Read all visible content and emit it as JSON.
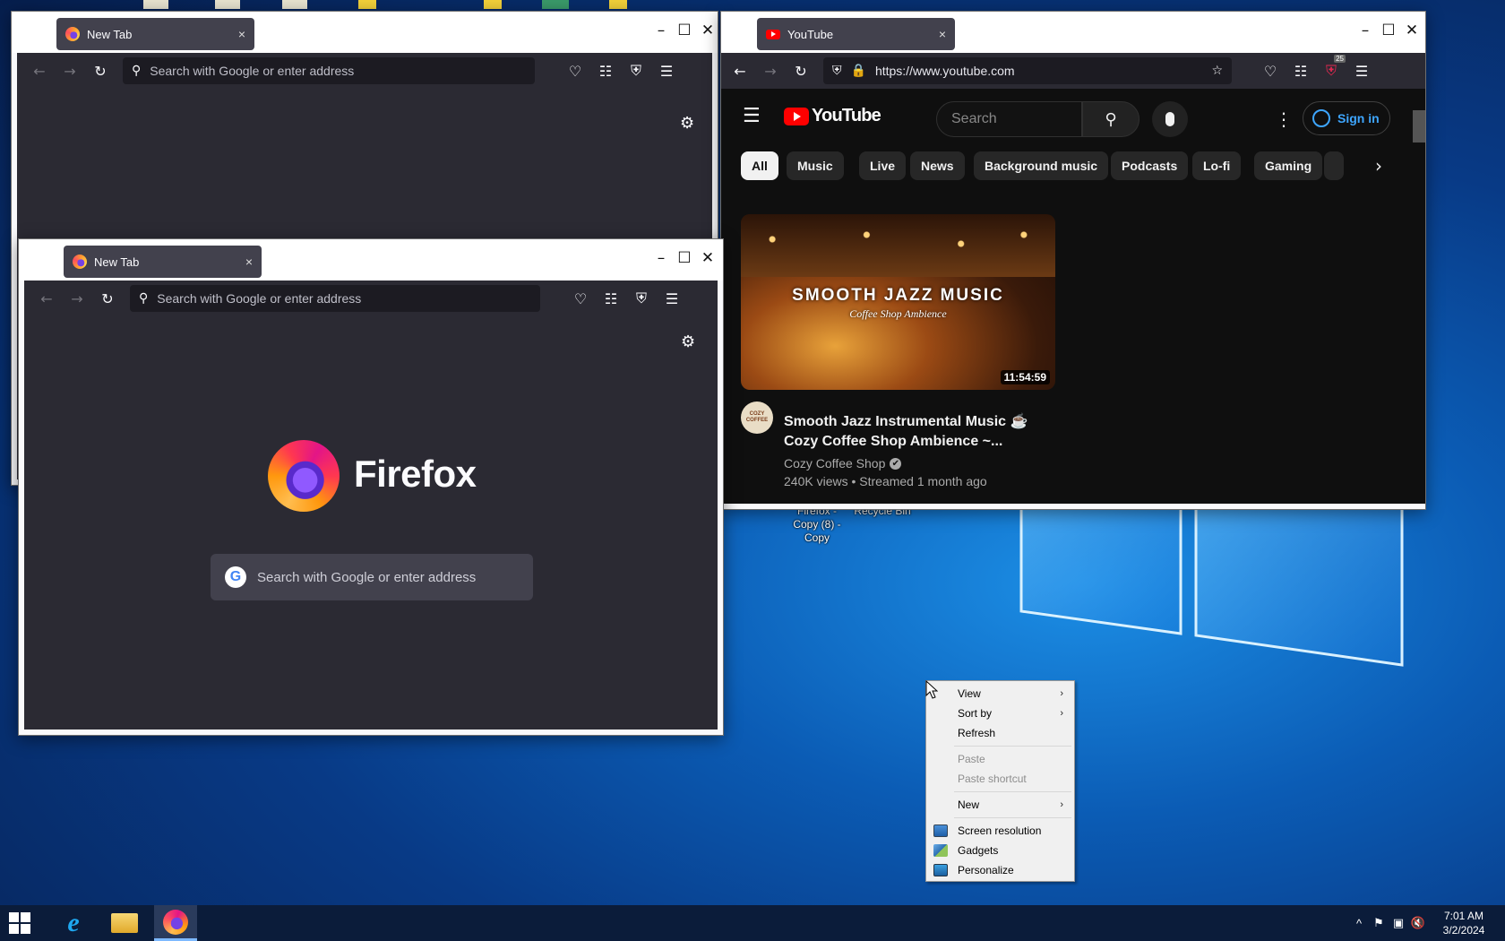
{
  "desktop": {
    "icons": [
      {
        "label": "Firefox - Copy (8) - Copy"
      },
      {
        "label": "Recycle Bin"
      }
    ]
  },
  "window_back": {
    "tab_title": "New Tab",
    "tab_close": "×",
    "url_placeholder": "Search with Google or enter address"
  },
  "window_front": {
    "tab_title": "New Tab",
    "tab_close": "×",
    "url_placeholder": "Search with Google or enter address",
    "brand_name": "Firefox",
    "search_placeholder": "Search with Google or enter address"
  },
  "window_youtube": {
    "tab_title": "YouTube",
    "tab_close": "×",
    "url": "https://www.youtube.com",
    "extension_badge": "25",
    "logo_text": "YouTube",
    "search_placeholder": "Search",
    "sign_in": "Sign in",
    "chips": [
      "All",
      "Music",
      "Live",
      "News",
      "Background music",
      "Podcasts",
      "Lo-fi",
      "Gaming"
    ],
    "video": {
      "thumb_title": "SMOOTH JAZZ MUSIC",
      "thumb_subtitle": "Coffee Shop Ambience",
      "duration": "11:54:59",
      "title_line1": "Smooth Jazz Instrumental Music ☕",
      "title_line2": "Cozy Coffee Shop Ambience ~...",
      "channel": "Cozy Coffee Shop",
      "verified": "✔",
      "meta": "240K views • Streamed 1 month ago",
      "avatar_text": "COZY COFFEE"
    }
  },
  "context_menu": {
    "items": [
      {
        "label": "View",
        "arrow": "›"
      },
      {
        "label": "Sort by",
        "arrow": "›"
      },
      {
        "label": "Refresh"
      },
      {
        "label": "Paste"
      },
      {
        "label": "Paste shortcut"
      },
      {
        "label": "New",
        "arrow": "›"
      },
      {
        "label": "Screen resolution",
        "icon": "monitor-icon"
      },
      {
        "label": "Gadgets",
        "icon": "gadgets-icon"
      },
      {
        "label": "Personalize",
        "icon": "personalize-icon"
      }
    ]
  },
  "taskbar": {
    "time": "7:01 AM",
    "date": "3/2/2024",
    "up_arrow": "^"
  },
  "colors": {
    "firefox_toolbar": "#2b2a33",
    "urlbar": "#1c1b22",
    "youtube_bg": "#0f0f0f",
    "youtube_red": "#ff0000",
    "signin_blue": "#3ea6ff",
    "taskbar": "#0b1c3a"
  }
}
